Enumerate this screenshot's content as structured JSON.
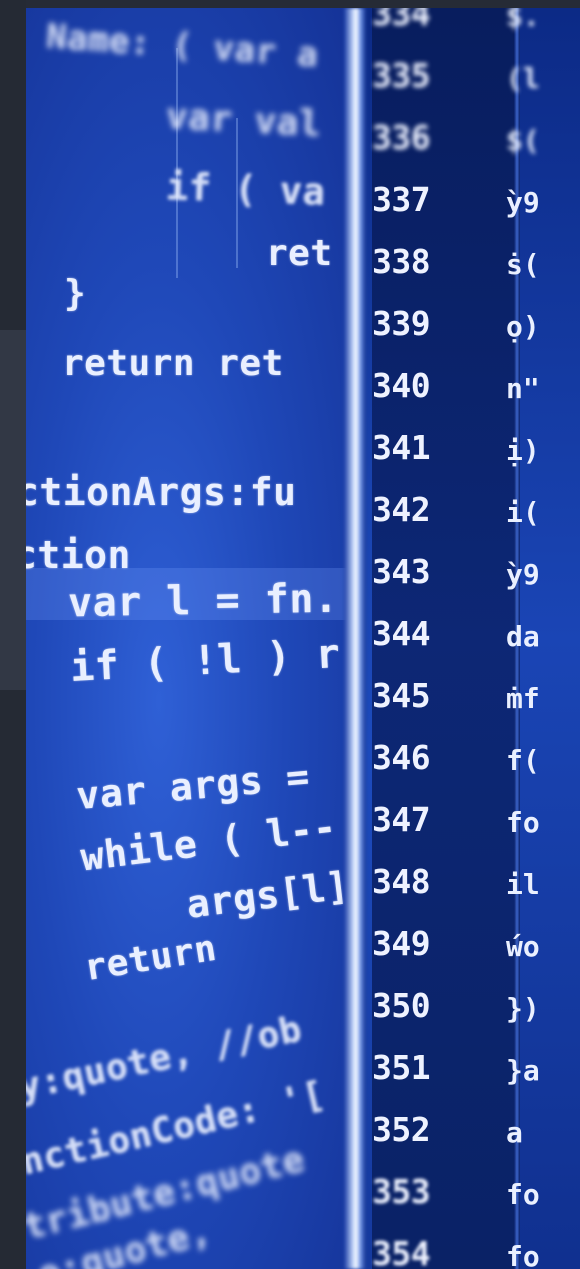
{
  "image": {
    "left_code": [
      {
        "text": "Name: ( var a"
      },
      {
        "text": "var val"
      },
      {
        "text": "if ( va"
      },
      {
        "text": "ret"
      },
      {
        "text": "}"
      },
      {
        "text": "return ret"
      },
      {
        "text": "ctionArgs:fu"
      },
      {
        "text": "ction"
      },
      {
        "text": "var l = fn."
      },
      {
        "text": "if ( !l ) r"
      },
      {
        "text": "var args = "
      },
      {
        "text": "while ( l--"
      },
      {
        "text": "args[l]"
      },
      {
        "text": "return"
      },
      {
        "text": "y:quote, //ob"
      },
      {
        "text": "nctionCode: '["
      },
      {
        "text": "tribute:quote"
      },
      {
        "text": "e:quote,"
      }
    ],
    "line_numbers": [
      "334",
      "335",
      "336",
      "337",
      "338",
      "339",
      "340",
      "341",
      "342",
      "343",
      "344",
      "345",
      "346",
      "347",
      "348",
      "349",
      "350",
      "351",
      "352",
      "353",
      "354"
    ],
    "right_code": [
      "$.",
      "(l",
      "$(",
      "ỳ9",
      "ṡ(",
      "ọ)",
      "n\"",
      "ị)",
      "i(",
      "ỳ9",
      "da",
      "ṁf",
      "f(",
      "fo",
      "il",
      "ẃo",
      "})",
      "}a",
      "a",
      "fo",
      "fo"
    ]
  },
  "colors": {
    "background": "#262b36",
    "code_bg": "#1f48b8",
    "gutter_bg": "#0d2775",
    "text": "#e9efff"
  }
}
